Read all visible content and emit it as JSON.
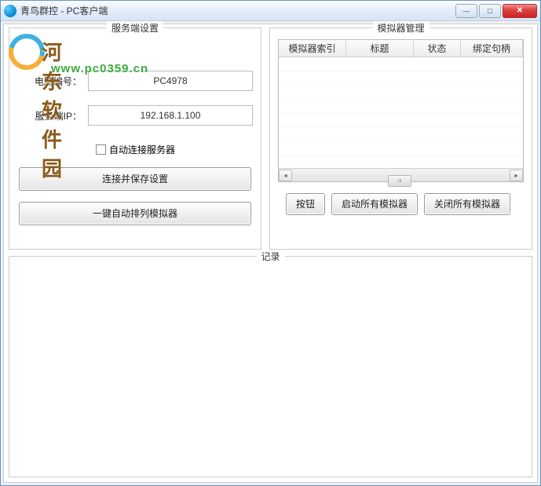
{
  "window": {
    "title": "青鸟群控 - PC客户端"
  },
  "watermark": {
    "brand": "河东软件园",
    "url": "www.pc0359.cn"
  },
  "server_panel": {
    "title": "服务端设置",
    "pc_id_label": "电脑编号：",
    "pc_id_value": "PC4978",
    "server_ip_label": "服务端IP：",
    "server_ip_value": "192.168.1.100",
    "auto_connect_label": "自动连接服务器",
    "connect_save_btn": "连接并保存设置",
    "arrange_btn": "一键自动排列模拟器"
  },
  "sim_panel": {
    "title": "模拟器管理",
    "columns": [
      "模拟器索引",
      "标题",
      "状态",
      "绑定句柄"
    ],
    "rows": [],
    "btn_generic": "按钮",
    "btn_start_all": "启动所有模拟器",
    "btn_close_all": "关闭所有模拟器"
  },
  "log_panel": {
    "title": "记录"
  }
}
